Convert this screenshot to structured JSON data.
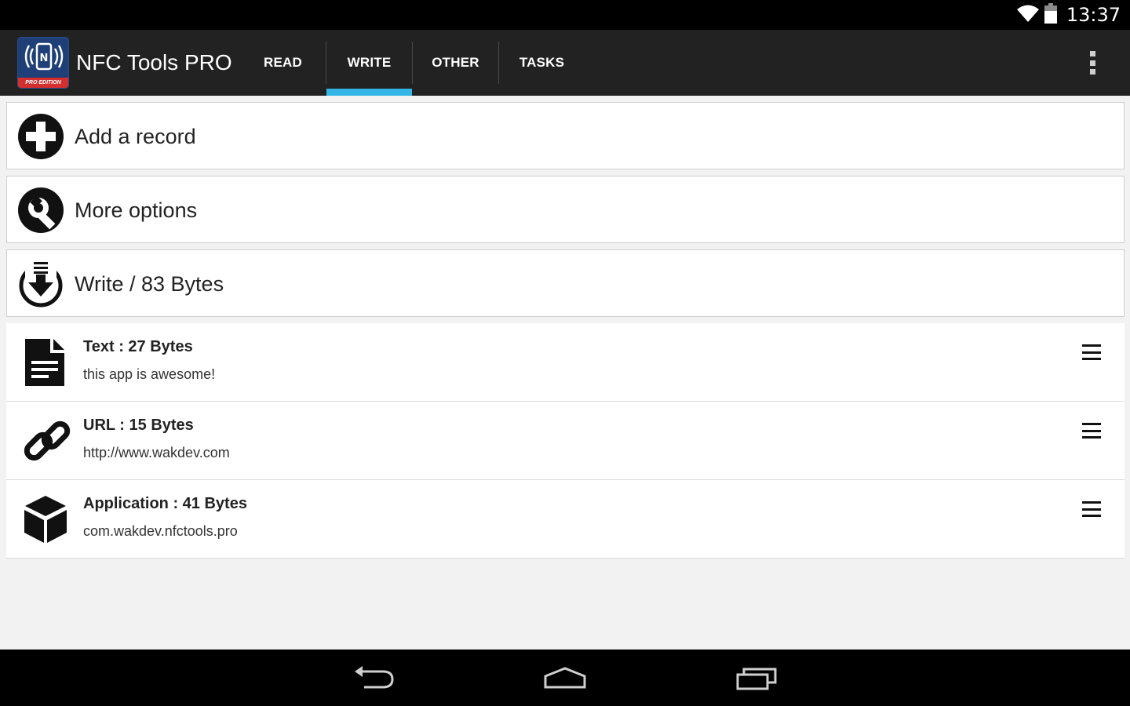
{
  "status_bar": {
    "time": "13:37",
    "icons": [
      "wifi-icon",
      "battery-icon"
    ]
  },
  "action_bar": {
    "app_title": "NFC Tools PRO",
    "logo_ribbon": "PRO EDITION",
    "tabs": [
      {
        "label": "READ",
        "active": false
      },
      {
        "label": "WRITE",
        "active": true
      },
      {
        "label": "OTHER",
        "active": false
      },
      {
        "label": "TASKS",
        "active": false
      }
    ],
    "accent_color": "#33b5e5"
  },
  "actions": {
    "add_record": "Add a record",
    "more_options": "More options",
    "write": "Write / 83 Bytes"
  },
  "records": [
    {
      "title": "Text : 27 Bytes",
      "value": "this app is awesome!",
      "icon": "document-icon"
    },
    {
      "title": "URL : 15 Bytes",
      "value": "http://www.wakdev.com",
      "icon": "link-icon"
    },
    {
      "title": "Application : 41 Bytes",
      "value": "com.wakdev.nfctools.pro",
      "icon": "cube-icon"
    }
  ],
  "nav_bar": {
    "buttons": [
      "back-icon",
      "home-icon",
      "recents-icon"
    ]
  }
}
